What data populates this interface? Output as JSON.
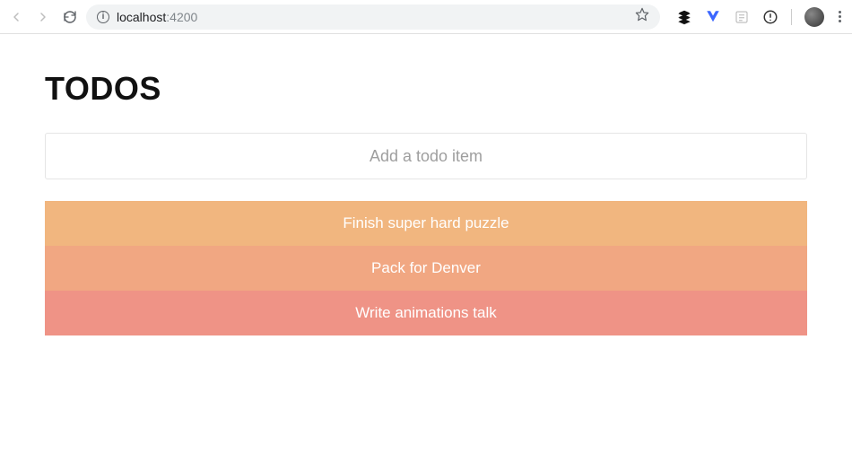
{
  "browser": {
    "url_host": "localhost",
    "url_port": ":4200"
  },
  "page": {
    "title": "TODOS",
    "input_placeholder": "Add a todo item",
    "todos": [
      "Finish super hard puzzle",
      "Pack for Denver",
      "Write animations talk"
    ]
  }
}
